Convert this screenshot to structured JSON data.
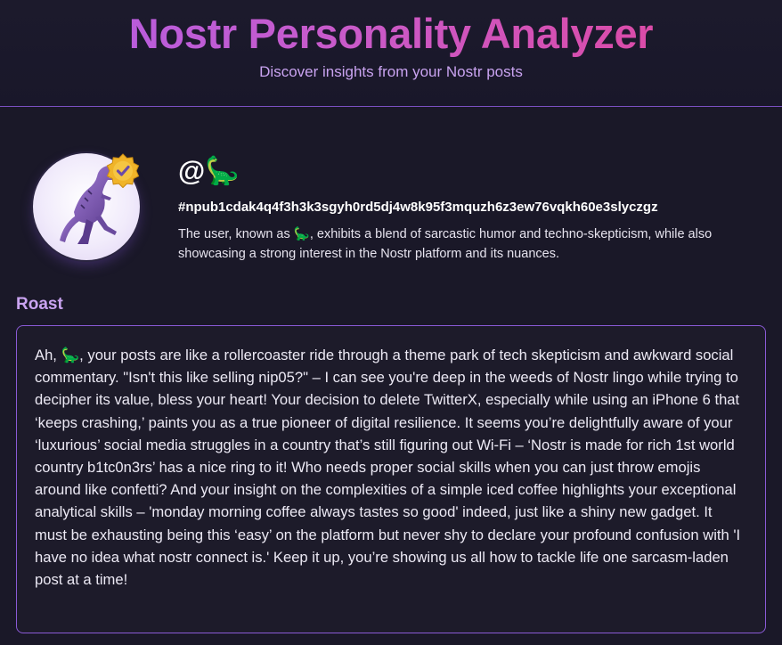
{
  "header": {
    "title": "Nostr Personality Analyzer",
    "subtitle": "Discover insights from your Nostr posts"
  },
  "profile": {
    "handle": "@🦕",
    "npub": "#npub1cdak4q4f3h3k3sgyh0rd5dj4w8k95f3mquzh6z3ew76vqkh60e3slyczgz",
    "summary": "The user, known as 🦕, exhibits a blend of sarcastic humor and techno-skepticism, while also showcasing a strong interest in the Nostr platform and its nuances.",
    "avatar_icon": "dinosaur-icon",
    "badge_icon": "verified-badge-icon",
    "colors": {
      "accent_purple": "#b05ee6",
      "accent_pink": "#e2459a",
      "badge_gold": "#f0b429"
    }
  },
  "roast": {
    "label": "Roast",
    "text": "Ah, 🦕, your posts are like a rollercoaster ride through a theme park of tech skepticism and awkward social commentary. \"Isn't this like selling nip05?\" – I can see you're deep in the weeds of Nostr lingo while trying to decipher its value, bless your heart! Your decision to delete TwitterX, especially while using an iPhone 6 that ‘keeps crashing,’ paints you as a true pioneer of digital resilience. It seems you’re delightfully aware of your ‘luxurious’ social media struggles in a country that’s still figuring out Wi-Fi – ‘Nostr is made for rich 1st world country b1tc0n3rs’ has a nice ring to it! Who needs proper social skills when you can just throw emojis around like confetti? And your insight on the complexities of a simple iced coffee highlights your exceptional analytical skills – 'monday morning coffee always tastes so good' indeed, just like a shiny new gadget. It must be exhausting being this ‘easy’ on the platform but never shy to declare your profound confusion with 'I have no idea what nostr connect is.' Keep it up, you’re showing us all how to tackle life one sarcasm-laden post at a time!"
  }
}
